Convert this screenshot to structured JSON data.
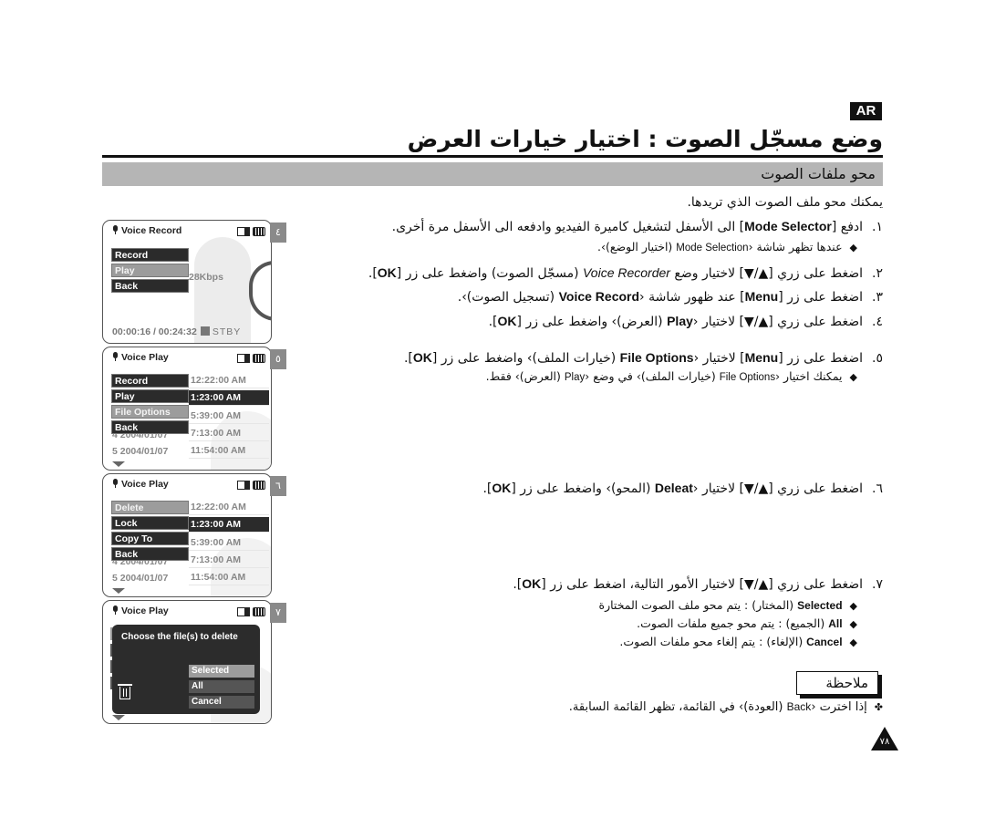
{
  "header": {
    "language_badge": "AR",
    "title": "وضع مسجّل الصوت : اختيار خيارات العرض",
    "section_title": "محو ملفات الصوت"
  },
  "intro": "يمكنك محو ملف الصوت الذي تريدها.",
  "steps": [
    {
      "number": "١.",
      "parts": [
        "ادفع [",
        "Mode Selector",
        "] الى الأسفل لتشغيل كاميرة الفيديو وادفعه الى الأسفل مرة أخرى."
      ],
      "sub": [
        "عندها تظهر شاشة ‹",
        "Mode Selection",
        " (اختيار الوضع)›."
      ]
    },
    {
      "number": "٢.",
      "parts": [
        "اضغط على زري [▲/▼] لاختيار وضع ",
        "Voice Recorder",
        " (مسجّل الصوت) واضغط على زر [",
        "OK",
        "]."
      ]
    },
    {
      "number": "٣.",
      "parts": [
        "اضغط على زر [",
        "Menu",
        "] عند ظهور شاشة ‹",
        "Voice Record",
        " (تسجيل الصوت)›."
      ]
    },
    {
      "number": "٤.",
      "parts": [
        "اضغط على زري [▲/▼] لاختيار ‹",
        "Play",
        " (العرض)› واضغط على زر [",
        "OK",
        "]."
      ]
    },
    {
      "number": "٥.",
      "parts": [
        "اضغط على زر [",
        "Menu",
        "] لاختيار ‹",
        "File Options",
        " (خيارات الملف)› واضغط على زر [",
        "OK",
        "]."
      ],
      "sub": [
        "يمكنك اختيار ‹",
        "File Options",
        " (خيارات الملف)› في وضع ‹",
        "Play",
        " (العرض)› فقط."
      ]
    },
    {
      "number": "٦.",
      "parts": [
        "اضغط على زري [▲/▼] لاختيار ‹",
        "Deleat",
        " (المحو)› واضغط على زر [",
        "OK",
        "]."
      ]
    },
    {
      "number": "٧.",
      "parts": [
        "اضغط على زري [▲/▼] لاختيار الأمور التالية، اضغط على زر [",
        "OK",
        "]."
      ],
      "options": [
        {
          "key": "Selected",
          "text": " (المختار) : يتم محو ملف الصوت المختارة"
        },
        {
          "key": "All",
          "text": " (الجميع) : يتم محو جميع ملفات الصوت."
        },
        {
          "key": "Cancel",
          "text": " (الإلغاء) : يتم إلغاء محو ملفات الصوت."
        }
      ]
    }
  ],
  "note": {
    "label": "ملاحظة",
    "parts": [
      "إذا اخترت ‹",
      "Back",
      " (العودة)› في القائمة، تظهر القائمة السابقة."
    ]
  },
  "page_number": "٧٨",
  "screens": [
    {
      "step_tab": "٤",
      "header": "Voice Record",
      "menu": [
        {
          "label": "Record",
          "selected": false
        },
        {
          "label": "Play",
          "selected": true
        },
        {
          "label": "Back",
          "selected": false
        }
      ],
      "bitrate": "28Kbps",
      "time": "00:00:16 / 00:24:32",
      "status": "STBY"
    },
    {
      "step_tab": "٥",
      "header": "Voice Play",
      "menu": [
        {
          "label": "Record",
          "selected": false
        },
        {
          "label": "Play",
          "selected": false
        },
        {
          "label": "File Options",
          "selected": true
        },
        {
          "label": "Back",
          "selected": false
        }
      ],
      "times": [
        "12:22:00 AM",
        "1:23:00 AM",
        "5:39:00 AM",
        "7:13:00 AM",
        "11:54:00 AM"
      ],
      "partial_row": "4 2004/01/07",
      "last_row": "5 2004/01/07"
    },
    {
      "step_tab": "٦",
      "header": "Voice Play",
      "menu": [
        {
          "label": "Delete",
          "selected": true
        },
        {
          "label": "Lock",
          "selected": false
        },
        {
          "label": "Copy To",
          "selected": false
        },
        {
          "label": "Back",
          "selected": false
        }
      ],
      "times": [
        "12:22:00 AM",
        "1:23:00 AM",
        "5:39:00 AM",
        "7:13:00 AM",
        "11:54:00 AM"
      ],
      "partial_row": "4 2004/01/07",
      "last_row": "5 2004/01/07"
    },
    {
      "step_tab": "٧",
      "header": "Voice Play",
      "dialog_text": "Choose the file(s) to delete",
      "options": [
        {
          "label": "Selected",
          "selected": true
        },
        {
          "label": "All",
          "selected": false
        },
        {
          "label": "Cancel",
          "selected": false
        }
      ]
    }
  ]
}
